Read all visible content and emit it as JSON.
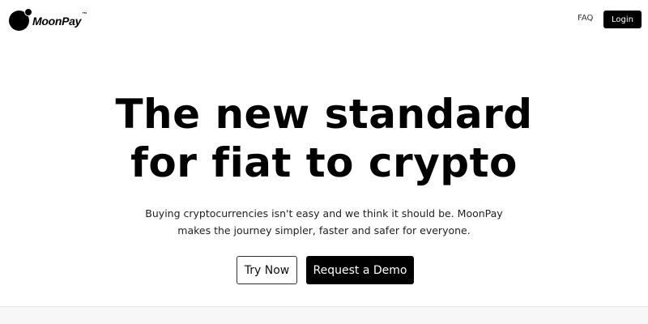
{
  "header": {
    "logo_text": "MoonPay",
    "logo_tm": "™",
    "faq_label": "FAQ",
    "login_label": "Login"
  },
  "hero": {
    "title_line1": "The new standard",
    "title_line2": "for fiat to crypto",
    "subtitle_line1": "Buying cryptocurrencies isn't easy and we think it should be. MoonPay",
    "subtitle_line2": "makes the journey simpler, faster and safer for everyone.",
    "try_now_label": "Try Now",
    "request_demo_label": "Request a Demo"
  },
  "colors": {
    "primary": "#000000",
    "background": "#ffffff",
    "text": "#111111",
    "panel": "#f7f7f7"
  }
}
